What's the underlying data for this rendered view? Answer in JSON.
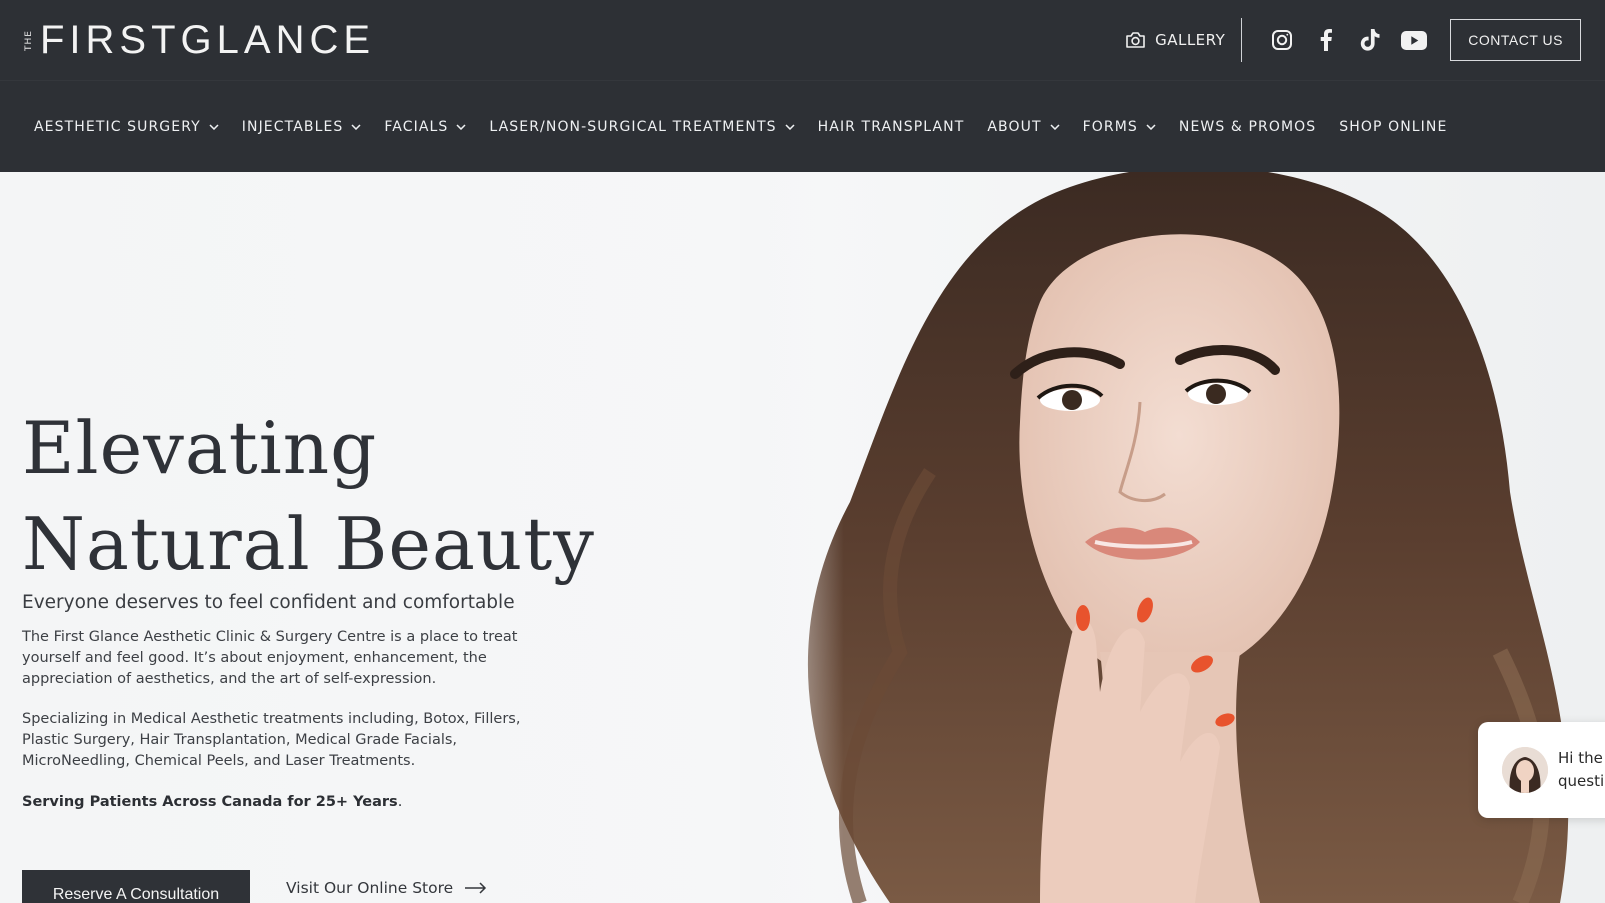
{
  "brand": {
    "logo_prefix": "THE",
    "logo_text": "FIRSTGLANCE"
  },
  "topbar": {
    "gallery_label": "GALLERY",
    "social": [
      "instagram-icon",
      "facebook-icon",
      "tiktok-icon",
      "youtube-icon"
    ],
    "contact_label": "CONTACT US"
  },
  "nav": {
    "items": [
      {
        "label": "AESTHETIC SURGERY",
        "dropdown": true
      },
      {
        "label": "INJECTABLES",
        "dropdown": true
      },
      {
        "label": "FACIALS",
        "dropdown": true
      },
      {
        "label": "LASER/NON-SURGICAL TREATMENTS",
        "dropdown": true
      },
      {
        "label": "HAIR TRANSPLANT",
        "dropdown": false
      },
      {
        "label": "ABOUT",
        "dropdown": true
      },
      {
        "label": "FORMS",
        "dropdown": true
      },
      {
        "label": "NEWS & PROMOS",
        "dropdown": false
      },
      {
        "label": "SHOP ONLINE",
        "dropdown": false
      }
    ]
  },
  "hero": {
    "headline_line1": "Elevating",
    "headline_line2": "Natural Beauty",
    "subhead": "Everyone deserves to feel confident and comfortable",
    "para1": "The First Glance Aesthetic Clinic & Surgery Centre is a place to treat yourself and feel good. It’s about enjoyment, enhancement, the appreciation of aesthetics, and the art of self-expression.",
    "para2": "Specializing in Medical Aesthetic treatments including, Botox, Fillers, Plastic Surgery, Hair Transplantation, Medical Grade Facials, MicroNeedling, Chemical Peels, and Laser Treatments.",
    "para3": "Serving Patients Across Canada for 25+ Years",
    "para3_suffix": ".",
    "cta_primary": "Reserve A Consultation",
    "cta_secondary": "Visit Our Online Store"
  },
  "chat": {
    "line1": "Hi the",
    "line2": "questi"
  },
  "colors": {
    "header_bg": "#2d3035",
    "hero_bg": "#f6f7f8",
    "text_dark": "#2f3238",
    "button_bg": "#2f3237"
  }
}
